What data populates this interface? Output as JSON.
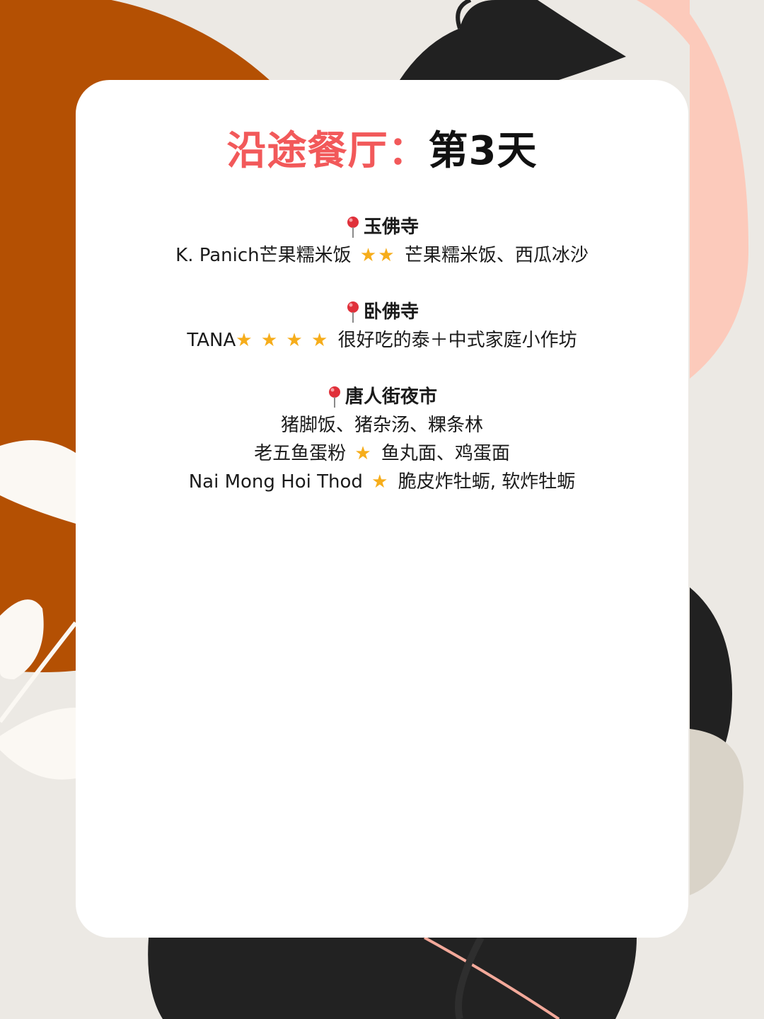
{
  "title": {
    "part1": "沿途餐厅：",
    "part2": "第3天"
  },
  "colors": {
    "accent": "#f2595a",
    "star": "#f6ad1b",
    "pin": "#e0303a",
    "card": "#ffffff",
    "background": "#ece9e4"
  },
  "sections": [
    {
      "name": "玉佛寺",
      "lines": [
        {
          "pre": "K. Panich芒果糯米饭",
          "stars": "★★",
          "post": "芒果糯米饭、西瓜冰沙"
        }
      ]
    },
    {
      "name": "卧佛寺",
      "lines": [
        {
          "pre": "TANA",
          "stars": "★ ★ ★ ★",
          "post": "很好吃的泰＋中式家庭小作坊"
        }
      ]
    },
    {
      "name": "唐人街夜市",
      "lines": [
        {
          "pre": "猪脚饭、猪杂汤、粿条林",
          "stars": "",
          "post": ""
        },
        {
          "pre": "老五鱼蛋粉",
          "stars": "★",
          "post": "鱼丸面、鸡蛋面"
        },
        {
          "pre": "Nai Mong Hoi Thod",
          "stars": "★",
          "post": "脆皮炸牡蛎, 软炸牡蛎"
        }
      ]
    }
  ]
}
